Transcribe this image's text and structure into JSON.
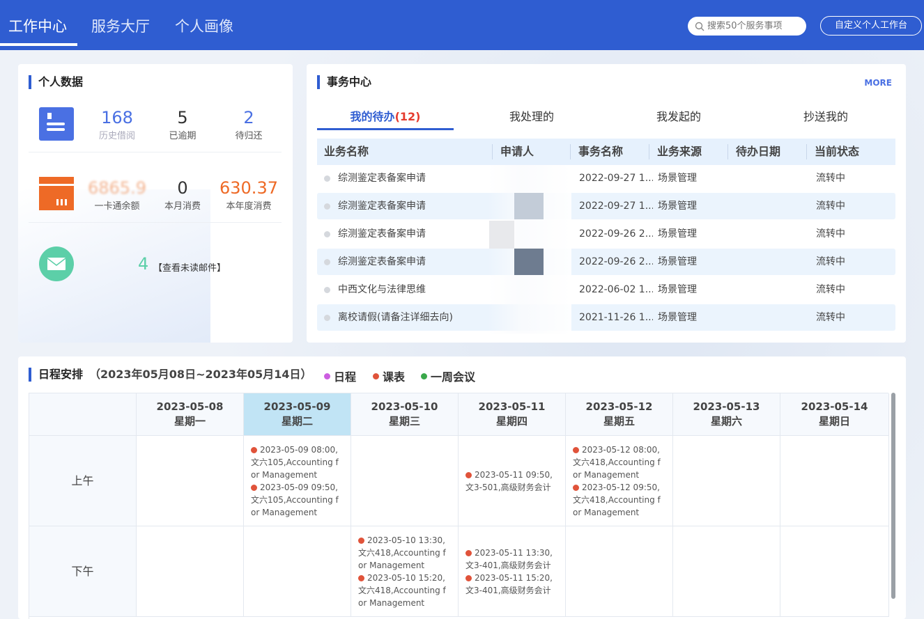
{
  "header": {
    "tabs": [
      {
        "label": "工作中心"
      },
      {
        "label": "服务大厅"
      },
      {
        "label": "个人画像"
      }
    ],
    "search_placeholder": "搜索50个服务事项",
    "custom_button": "自定义个人工作台"
  },
  "personal": {
    "title": "个人数据",
    "library": [
      {
        "value": "168",
        "label": "历史借阅"
      },
      {
        "value": "5",
        "label": "已逾期"
      },
      {
        "value": "2",
        "label": "待归还"
      }
    ],
    "card": [
      {
        "value": "6865.9",
        "label": "一卡通余额"
      },
      {
        "value": "0",
        "label": "本月消费"
      },
      {
        "value": "630.37",
        "label": "本年度消费"
      }
    ],
    "mail_count": "4",
    "mail_link": "【查看未读邮件】",
    "colors": {
      "library": "#4a70e3",
      "card": "#ee6a26",
      "mail": "#5ccfa8"
    }
  },
  "affairs": {
    "title": "事务中心",
    "more": "MORE",
    "tabs": [
      {
        "label": "我的待办",
        "count": "(12)"
      },
      {
        "label": "我处理的"
      },
      {
        "label": "我发起的"
      },
      {
        "label": "抄送我的"
      }
    ],
    "columns": [
      "业务名称",
      "申请人",
      "事务名称",
      "业务来源",
      "待办日期",
      "当前状态"
    ],
    "rows": [
      {
        "name": "综测鉴定表备案申请",
        "applicant": "",
        "date": "2022-09-27 1...",
        "source": "场景管理",
        "status": "流转中"
      },
      {
        "name": "综测鉴定表备案申请",
        "applicant": "",
        "date": "2022-09-27 1...",
        "source": "场景管理",
        "status": "流转中"
      },
      {
        "name": "综测鉴定表备案申请",
        "applicant": "",
        "date": "2022-09-26 2...",
        "source": "场景管理",
        "status": "流转中"
      },
      {
        "name": "综测鉴定表备案申请",
        "applicant": "",
        "date": "2022-09-26 2...",
        "source": "场景管理",
        "status": "流转中"
      },
      {
        "name": "中西文化与法律思维",
        "applicant": "",
        "date": "2022-06-02 1...",
        "source": "场景管理",
        "status": "流转中"
      },
      {
        "name": "离校请假(请备注详细去向)",
        "applicant": "",
        "date": "2021-11-26 1...",
        "source": "场景管理",
        "status": "流转中"
      }
    ]
  },
  "schedule": {
    "title": "日程安排",
    "range": "（2023年05月08日~2023年05月14日）",
    "legend": [
      {
        "label": "日程",
        "color": "#cc5ee0"
      },
      {
        "label": "课表",
        "color": "#e0533a"
      },
      {
        "label": "一周会议",
        "color": "#3aa84a"
      }
    ],
    "days": [
      {
        "date": "2023-05-08",
        "weekday": "星期一"
      },
      {
        "date": "2023-05-09",
        "weekday": "星期二"
      },
      {
        "date": "2023-05-10",
        "weekday": "星期三"
      },
      {
        "date": "2023-05-11",
        "weekday": "星期四"
      },
      {
        "date": "2023-05-12",
        "weekday": "星期五"
      },
      {
        "date": "2023-05-13",
        "weekday": "星期六"
      },
      {
        "date": "2023-05-14",
        "weekday": "星期日"
      }
    ],
    "periods": [
      "上午",
      "下午"
    ],
    "events": {
      "am_tue_1": "2023-05-09 08:00,文六105,Accounting for Management",
      "am_tue_2": "2023-05-09 09:50,文六105,Accounting for Management",
      "am_thu_1": "2023-05-11 09:50,文3-501,高级财务会计",
      "am_fri_1": "2023-05-12 08:00,文六418,Accounting for Management",
      "am_fri_2": "2023-05-12 09:50,文六418,Accounting for Management",
      "pm_wed_1": "2023-05-10 13:30,文六418,Accounting for Management",
      "pm_wed_2": "2023-05-10 15:20,文六418,Accounting for Management",
      "pm_thu_1": "2023-05-11 13:30,文3-401,高级财务会计",
      "pm_thu_2": "2023-05-11 15:20,文3-401,高级财务会计"
    }
  }
}
